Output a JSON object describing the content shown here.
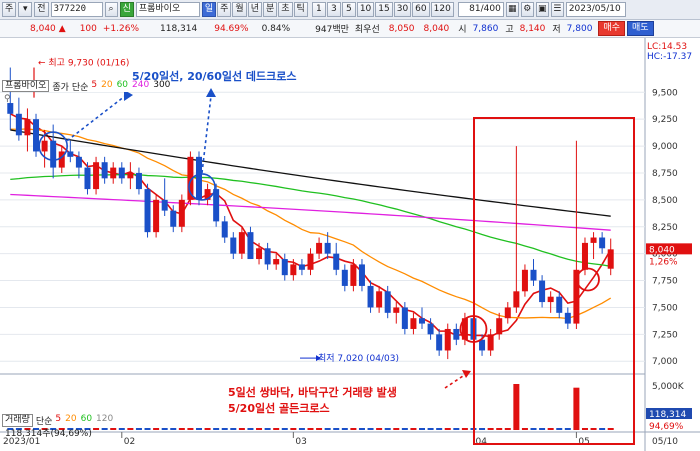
{
  "toolbar": {
    "mode": "주",
    "prev_label": "전",
    "code": "377220",
    "search_icon": "search-icon",
    "theme_label": "신",
    "stock_name": "프롬바이오",
    "periods": [
      "일",
      "주",
      "월",
      "년",
      "분",
      "초",
      "틱"
    ],
    "period_selected": "일",
    "intervals": [
      "1",
      "3",
      "5",
      "10",
      "15",
      "30",
      "60",
      "120"
    ],
    "page_count": "81/400",
    "date": "2023/05/10"
  },
  "quote": {
    "price": "8,040",
    "arrow": "▲",
    "change": "100",
    "change_pct": "+1.26%",
    "volume": "118,314",
    "ratio": "94.69%",
    "turnover": "0.84%",
    "amount": "947백만",
    "best_label": "최우선",
    "ask": "8,050",
    "bid": "8,040",
    "open_label": "시",
    "open": "7,860",
    "high_label": "고",
    "high": "8,140",
    "low_label": "저",
    "low": "7,800",
    "buy_label": "매수",
    "sell_label": "매도"
  },
  "indicator": {
    "name": "프롬바이오",
    "chart_type": "종가 단순",
    "ma_periods": [
      "5",
      "20",
      "60",
      "240",
      "300"
    ],
    "ma_colors": [
      "#e01010",
      "#ff8c00",
      "#20c020",
      "#e020e0",
      "#111111"
    ],
    "pin_icon": "pin-icon"
  },
  "volume_panel": {
    "name": "거래량",
    "chart_type": "단순",
    "ma_periods": [
      "5",
      "20",
      "60",
      "120"
    ],
    "value": "118,314주(94,69%)",
    "current_tag": "118,314",
    "ratio_tag": "94,69%",
    "axis_label": "5,000K"
  },
  "right_axis": {
    "lc": "LC:14.53",
    "hc": "HC:-17.37",
    "ticks": [
      "9,500",
      "9,250",
      "9,000",
      "8,750",
      "8,500",
      "8,250",
      "8,000",
      "7,750",
      "7,500",
      "7,250",
      "7,000"
    ],
    "price_tag": "8,040",
    "pct_tag": "1,26%"
  },
  "x_axis": {
    "months": [
      "2023/01",
      "02",
      "03",
      "04",
      "05"
    ],
    "end_label": "05/10"
  },
  "annotations": {
    "high_mark": "최고 9,730 (01/16)",
    "low_mark": "최저 7,020 (04/03)",
    "dead_cross": "5/20일선, 20/60일선 데드크로스",
    "bottom_note_1": "5일선 쌍바닥, 바닥구간 거래량 발생",
    "bottom_note_2": "5/20일선 골든크로스"
  },
  "chart_data": {
    "type": "candlestick",
    "ylim": [
      6900,
      9800
    ],
    "candles": [
      [
        9400,
        9730,
        9150,
        9300
      ],
      [
        9300,
        9450,
        9050,
        9100
      ],
      [
        9100,
        9350,
        8950,
        9250
      ],
      [
        9250,
        9300,
        8900,
        8950
      ],
      [
        8950,
        9150,
        8800,
        9050
      ],
      [
        9050,
        9200,
        8700,
        8800
      ],
      [
        8800,
        9000,
        8750,
        8950
      ],
      [
        8950,
        9050,
        8850,
        8900
      ],
      [
        8900,
        8950,
        8700,
        8800
      ],
      [
        8800,
        8850,
        8550,
        8600
      ],
      [
        8600,
        8900,
        8550,
        8850
      ],
      [
        8850,
        8900,
        8650,
        8700
      ],
      [
        8700,
        8850,
        8650,
        8800
      ],
      [
        8800,
        8850,
        8650,
        8700
      ],
      [
        8700,
        8850,
        8600,
        8750
      ],
      [
        8750,
        8800,
        8550,
        8600
      ],
      [
        8600,
        8650,
        8150,
        8200
      ],
      [
        8200,
        8550,
        8150,
        8500
      ],
      [
        8500,
        8700,
        8350,
        8400
      ],
      [
        8400,
        8450,
        8200,
        8250
      ],
      [
        8250,
        8550,
        8200,
        8500
      ],
      [
        8500,
        8950,
        8450,
        8900
      ],
      [
        8900,
        8950,
        8450,
        8500
      ],
      [
        8500,
        8650,
        8450,
        8600
      ],
      [
        8600,
        8650,
        8250,
        8300
      ],
      [
        8300,
        8350,
        8100,
        8150
      ],
      [
        8150,
        8200,
        7950,
        8000
      ],
      [
        8000,
        8250,
        7950,
        8200
      ],
      [
        8200,
        8250,
        7950,
        7950
      ],
      [
        7950,
        8100,
        7900,
        8050
      ],
      [
        8050,
        8100,
        7850,
        7900
      ],
      [
        7900,
        8000,
        7850,
        7950
      ],
      [
        7950,
        8000,
        7750,
        7800
      ],
      [
        7800,
        7950,
        7750,
        7900
      ],
      [
        7900,
        7950,
        7800,
        7850
      ],
      [
        7850,
        8050,
        7800,
        8000
      ],
      [
        8000,
        8150,
        7950,
        8100
      ],
      [
        8100,
        8200,
        7950,
        8000
      ],
      [
        8000,
        8100,
        7800,
        7850
      ],
      [
        7850,
        7900,
        7650,
        7700
      ],
      [
        7700,
        7950,
        7650,
        7900
      ],
      [
        7900,
        7950,
        7650,
        7700
      ],
      [
        7700,
        7750,
        7450,
        7500
      ],
      [
        7500,
        7700,
        7450,
        7650
      ],
      [
        7650,
        7700,
        7400,
        7450
      ],
      [
        7450,
        7550,
        7350,
        7500
      ],
      [
        7500,
        7550,
        7250,
        7300
      ],
      [
        7300,
        7450,
        7250,
        7400
      ],
      [
        7400,
        7500,
        7300,
        7350
      ],
      [
        7350,
        7400,
        7200,
        7250
      ],
      [
        7250,
        7300,
        7050,
        7100
      ],
      [
        7100,
        7350,
        7020,
        7300
      ],
      [
        7300,
        7350,
        7150,
        7200
      ],
      [
        7200,
        7450,
        7150,
        7400
      ],
      [
        7400,
        7450,
        7150,
        7200
      ],
      [
        7200,
        7250,
        7050,
        7100
      ],
      [
        7100,
        7300,
        7050,
        7250
      ],
      [
        7250,
        7450,
        7200,
        7400
      ],
      [
        7400,
        7550,
        7350,
        7500
      ],
      [
        7500,
        9000,
        7450,
        7650
      ],
      [
        7650,
        7900,
        7600,
        7850
      ],
      [
        7850,
        7950,
        7700,
        7750
      ],
      [
        7750,
        7800,
        7500,
        7550
      ],
      [
        7550,
        7650,
        7450,
        7600
      ],
      [
        7600,
        7650,
        7400,
        7450
      ],
      [
        7450,
        7500,
        7300,
        7350
      ],
      [
        7350,
        9050,
        7300,
        7850
      ],
      [
        7850,
        8150,
        7800,
        8100
      ],
      [
        8100,
        8200,
        7950,
        8150
      ],
      [
        8150,
        8200,
        8000,
        8050
      ],
      [
        7860,
        8140,
        7800,
        8040
      ]
    ],
    "ma_series": [
      {
        "name": "5",
        "color": "#e01010"
      },
      {
        "name": "20",
        "color": "#ff8c00"
      },
      {
        "name": "60",
        "color": "#20c020"
      },
      {
        "name": "240",
        "color": "#e020e0"
      },
      {
        "name": "300",
        "color": "#111111"
      }
    ],
    "volume": [
      {
        "index": 59,
        "value": 5000
      },
      {
        "index": 66,
        "value": 4600
      }
    ]
  }
}
